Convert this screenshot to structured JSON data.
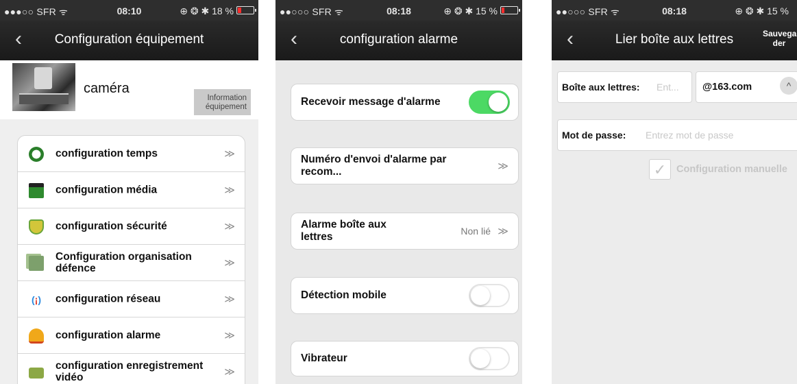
{
  "colors": {
    "nav_bg": "#1e1e1e",
    "toggle_on": "#4cd964",
    "battery_low": "#ff2d2d"
  },
  "screen1": {
    "status": {
      "carrier": "●●●○○ SFR ᯤ",
      "time": "08:10",
      "right": "⊕ ❂ ✱ 18 %",
      "battery_level": 0.18
    },
    "nav": {
      "back": "‹",
      "title": "Configuration équipement"
    },
    "device": {
      "name": "caméra",
      "info_button": "Information\néquipement"
    },
    "menu": [
      {
        "label": "configuration temps",
        "icon": "clock-icon",
        "chevron": "≫"
      },
      {
        "label": "configuration média",
        "icon": "clapperboard-icon",
        "chevron": "≫"
      },
      {
        "label": "configuration sécurité",
        "icon": "shield-icon",
        "chevron": "≫"
      },
      {
        "label": "Configuration organisation défence",
        "icon": "documents-icon",
        "chevron": "≫"
      },
      {
        "label": "configuration réseau",
        "icon": "wifi-antenna-icon",
        "chevron": "≫"
      },
      {
        "label": "configuration alarme",
        "icon": "bell-icon",
        "chevron": "≫"
      },
      {
        "label": "configuration enregistrement vidéo",
        "icon": "video-camera-icon",
        "chevron": "≫"
      }
    ]
  },
  "screen2": {
    "status": {
      "carrier": "●●○○○ SFR ᯤ",
      "time": "08:18",
      "right": "⊕ ❂ ✱ 15 %",
      "battery_level": 0.15
    },
    "nav": {
      "back": "‹",
      "title": "configuration alarme"
    },
    "items": [
      {
        "label": "Recevoir message d'alarme",
        "toggle": true
      },
      {
        "label": "Numéro d'envoi d'alarme par recom...",
        "chevron": "≫"
      },
      {
        "label": "Alarme boîte aux lettres",
        "value": "Non lié",
        "chevron": "≫"
      },
      {
        "label": "Détection mobile",
        "toggle": false
      },
      {
        "label": "Vibrateur",
        "toggle": false
      }
    ]
  },
  "screen3": {
    "status": {
      "carrier": "●●○○○ SFR ᯤ",
      "time": "08:18",
      "right": "⊕ ❂ ✱ 15 %",
      "battery_level": 0.15
    },
    "nav": {
      "back": "‹",
      "title": "Lier boîte aux lettres",
      "save": "Sauvega\nder"
    },
    "mailbox": {
      "label": "Boîte aux lettres:",
      "placeholder": "Ent...",
      "domain": "@163.com",
      "up_button": "^"
    },
    "password": {
      "label": "Mot de passe:",
      "placeholder": "Entrez mot de passe"
    },
    "manual": {
      "checkmark": "✓",
      "label": "Configuration manuelle",
      "checked": true
    }
  }
}
